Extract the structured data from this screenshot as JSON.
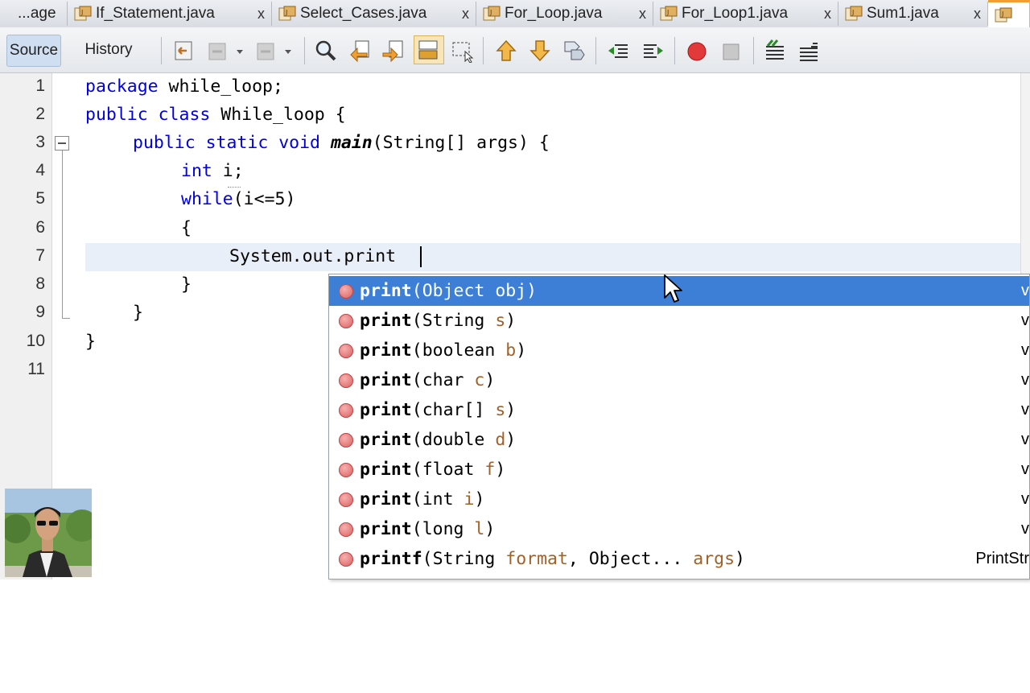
{
  "tabs": [
    {
      "label": "...age",
      "closable": false
    },
    {
      "label": "If_Statement.java",
      "close": "x"
    },
    {
      "label": "Select_Cases.java",
      "close": "x"
    },
    {
      "label": "For_Loop.java",
      "close": "x"
    },
    {
      "label": "For_Loop1.java",
      "close": "x"
    },
    {
      "label": "Sum1.java",
      "close": "x"
    }
  ],
  "toolbar": {
    "source_label": "Source",
    "history_label": "History",
    "icons": [
      "last-edit-icon",
      "back-icon",
      "forward-icon",
      "find-icon",
      "find-previous-icon",
      "find-next-icon",
      "toggle-highlight-icon",
      "toggle-rect-selection-icon",
      "previous-bookmark-icon",
      "next-bookmark-icon",
      "toggle-bookmark-icon",
      "shift-left-icon",
      "shift-right-icon",
      "start-macro-icon",
      "stop-macro-icon",
      "comment-icon",
      "uncomment-icon"
    ]
  },
  "editor": {
    "line_numbers": [
      "1",
      "2",
      "3",
      "4",
      "5",
      "6",
      "7",
      "8",
      "9",
      "10",
      "11"
    ],
    "lines": {
      "l1_kw": "package",
      "l1_rest": " while_loop;",
      "l2_kw": "public class",
      "l2_rest": " While_loop {",
      "l3_kw": "public static void",
      "l3_method": "main",
      "l3_rest": "(String[] args) {",
      "l4_kw": "int",
      "l4_rest": " i;",
      "l5_kw": "while",
      "l5_rest": "(i<=5)",
      "l6": "{",
      "l7": "System.out.print",
      "l8": "}",
      "l9": "}",
      "l10": "}"
    }
  },
  "completion": {
    "items": [
      {
        "name": "print",
        "open": "(",
        "type": "Object",
        "param": "obj",
        "close": ")",
        "ret": "v"
      },
      {
        "name": "print",
        "open": "(",
        "type": "String",
        "param": "s",
        "close": ")",
        "ret": "v"
      },
      {
        "name": "print",
        "open": "(",
        "type": "boolean",
        "param": "b",
        "close": ")",
        "ret": "v"
      },
      {
        "name": "print",
        "open": "(",
        "type": "char",
        "param": "c",
        "close": ")",
        "ret": "v"
      },
      {
        "name": "print",
        "open": "(",
        "type": "char[]",
        "param": "s",
        "close": ")",
        "ret": "v"
      },
      {
        "name": "print",
        "open": "(",
        "type": "double",
        "param": "d",
        "close": ")",
        "ret": "v"
      },
      {
        "name": "print",
        "open": "(",
        "type": "float",
        "param": "f",
        "close": ")",
        "ret": "v"
      },
      {
        "name": "print",
        "open": "(",
        "type": "int",
        "param": "i",
        "close": ")",
        "ret": "v"
      },
      {
        "name": "print",
        "open": "(",
        "type": "long",
        "param": "l",
        "close": ")",
        "ret": "v"
      },
      {
        "name": "printf",
        "open": "(",
        "type": "String",
        "param": "format",
        "sep": ", ",
        "type2": "Object...",
        "param2": "args",
        "close": ")",
        "ret": "PrintStr"
      }
    ],
    "selected_index": 0
  },
  "colors": {
    "keyword": "#0000e6",
    "selection": "#3d7fd6",
    "param": "#a0622a",
    "current_line": "#e9eff8"
  }
}
